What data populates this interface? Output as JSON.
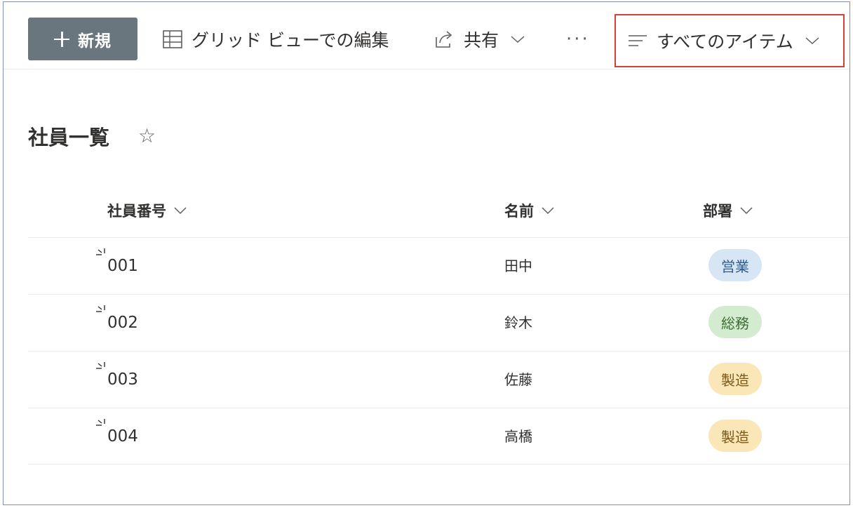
{
  "command_bar": {
    "new_label": "新規",
    "grid_edit_label": "グリッド ビューでの編集",
    "share_label": "共有",
    "more_label": "···",
    "view_label": "すべてのアイテム"
  },
  "page": {
    "title": "社員一覧"
  },
  "columns": {
    "id": "社員番号",
    "name": "名前",
    "dept": "部署"
  },
  "rows": [
    {
      "id": "001",
      "name": "田中",
      "dept": "営業",
      "dept_bg": "#d6e6f5",
      "dept_fg": "#2b5a8f"
    },
    {
      "id": "002",
      "name": "鈴木",
      "dept": "総務",
      "dept_bg": "#d3eccf",
      "dept_fg": "#3d6b34"
    },
    {
      "id": "003",
      "name": "佐藤",
      "dept": "製造",
      "dept_bg": "#fbe6b8",
      "dept_fg": "#7a5a16"
    },
    {
      "id": "004",
      "name": "高橋",
      "dept": "製造",
      "dept_bg": "#fbe6b8",
      "dept_fg": "#7a5a16"
    }
  ],
  "colors": {
    "new_button_bg": "#69767d",
    "highlight_border": "#d6403a",
    "frame_border": "#7f8fb8"
  },
  "icons": {
    "new": "plus-icon",
    "grid": "grid-icon",
    "share": "share-icon",
    "view": "view-lines-icon",
    "favorite": "star-icon",
    "dropdown": "chevron-down-icon",
    "new_item": "new-item-sparkle-icon"
  }
}
